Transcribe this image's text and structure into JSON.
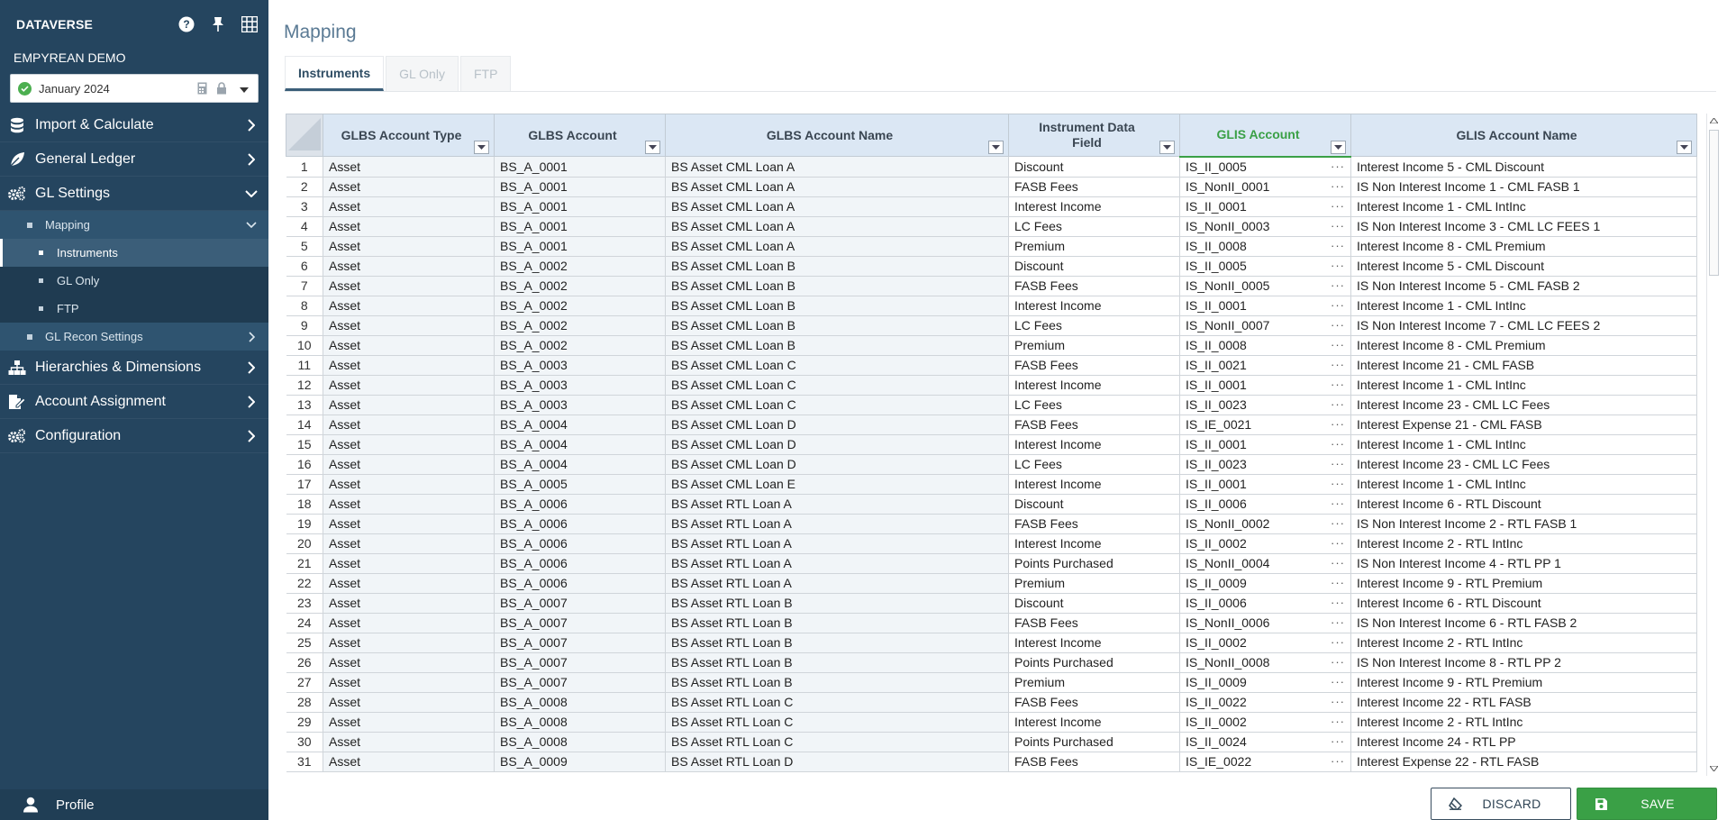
{
  "sidebar": {
    "brand": "DATAVERSE",
    "org": "EMPYREAN DEMO",
    "period": "January 2024",
    "menu": {
      "import_calc": "Import & Calculate",
      "general_ledger": "General Ledger",
      "gl_settings": "GL Settings",
      "mapping": "Mapping",
      "instruments": "Instruments",
      "gl_only": "GL Only",
      "ftp": "FTP",
      "gl_recon": "GL Recon Settings",
      "hierarchies": "Hierarchies & Dimensions",
      "account_assignment": "Account Assignment",
      "configuration": "Configuration"
    },
    "profile": "Profile"
  },
  "main": {
    "title": "Mapping",
    "tabs": [
      "Instruments",
      "GL Only",
      "FTP"
    ]
  },
  "grid": {
    "headers": {
      "type": "GLBS Account Type",
      "account": "GLBS Account",
      "name": "GLBS Account Name",
      "field_l1": "Instrument Data",
      "field_l2": "Field",
      "glis": "GLIS Account",
      "glis_name": "GLIS Account Name"
    },
    "rows": [
      [
        "1",
        "Asset",
        "BS_A_0001",
        "BS Asset CML Loan A",
        "Discount",
        "IS_II_0005",
        "Interest Income 5 - CML Discount"
      ],
      [
        "2",
        "Asset",
        "BS_A_0001",
        "BS Asset CML Loan A",
        "FASB Fees",
        "IS_NonII_0001",
        "IS Non Interest Income 1 - CML FASB 1"
      ],
      [
        "3",
        "Asset",
        "BS_A_0001",
        "BS Asset CML Loan A",
        "Interest Income",
        "IS_II_0001",
        "Interest Income 1 - CML IntInc"
      ],
      [
        "4",
        "Asset",
        "BS_A_0001",
        "BS Asset CML Loan A",
        "LC Fees",
        "IS_NonII_0003",
        "IS Non Interest Income 3 - CML LC FEES 1"
      ],
      [
        "5",
        "Asset",
        "BS_A_0001",
        "BS Asset CML Loan A",
        "Premium",
        "IS_II_0008",
        "Interest Income 8 - CML Premium"
      ],
      [
        "6",
        "Asset",
        "BS_A_0002",
        "BS Asset CML Loan B",
        "Discount",
        "IS_II_0005",
        "Interest Income 5 - CML Discount"
      ],
      [
        "7",
        "Asset",
        "BS_A_0002",
        "BS Asset CML Loan B",
        "FASB Fees",
        "IS_NonII_0005",
        "IS Non Interest Income 5 - CML FASB 2"
      ],
      [
        "8",
        "Asset",
        "BS_A_0002",
        "BS Asset CML Loan B",
        "Interest Income",
        "IS_II_0001",
        "Interest Income 1 - CML IntInc"
      ],
      [
        "9",
        "Asset",
        "BS_A_0002",
        "BS Asset CML Loan B",
        "LC Fees",
        "IS_NonII_0007",
        "IS Non Interest Income 7 - CML LC FEES 2"
      ],
      [
        "10",
        "Asset",
        "BS_A_0002",
        "BS Asset CML Loan B",
        "Premium",
        "IS_II_0008",
        "Interest Income 8 - CML Premium"
      ],
      [
        "11",
        "Asset",
        "BS_A_0003",
        "BS Asset CML Loan C",
        "FASB Fees",
        "IS_II_0021",
        "Interest Income 21 - CML FASB"
      ],
      [
        "12",
        "Asset",
        "BS_A_0003",
        "BS Asset CML Loan C",
        "Interest Income",
        "IS_II_0001",
        "Interest Income 1 - CML IntInc"
      ],
      [
        "13",
        "Asset",
        "BS_A_0003",
        "BS Asset CML Loan C",
        "LC Fees",
        "IS_II_0023",
        "Interest Income 23 - CML LC Fees"
      ],
      [
        "14",
        "Asset",
        "BS_A_0004",
        "BS Asset CML Loan D",
        "FASB Fees",
        "IS_IE_0021",
        "Interest Expense 21 - CML FASB"
      ],
      [
        "15",
        "Asset",
        "BS_A_0004",
        "BS Asset CML Loan D",
        "Interest Income",
        "IS_II_0001",
        "Interest Income 1 - CML IntInc"
      ],
      [
        "16",
        "Asset",
        "BS_A_0004",
        "BS Asset CML Loan D",
        "LC Fees",
        "IS_II_0023",
        "Interest Income 23 - CML LC Fees"
      ],
      [
        "17",
        "Asset",
        "BS_A_0005",
        "BS Asset CML Loan E",
        "Interest Income",
        "IS_II_0001",
        "Interest Income 1 - CML IntInc"
      ],
      [
        "18",
        "Asset",
        "BS_A_0006",
        "BS Asset RTL Loan A",
        "Discount",
        "IS_II_0006",
        "Interest Income 6 - RTL Discount"
      ],
      [
        "19",
        "Asset",
        "BS_A_0006",
        "BS Asset RTL Loan A",
        "FASB Fees",
        "IS_NonII_0002",
        "IS Non Interest Income 2  - RTL FASB 1"
      ],
      [
        "20",
        "Asset",
        "BS_A_0006",
        "BS Asset RTL Loan A",
        "Interest Income",
        "IS_II_0002",
        "Interest Income 2 - RTL IntInc"
      ],
      [
        "21",
        "Asset",
        "BS_A_0006",
        "BS Asset RTL Loan A",
        "Points Purchased",
        "IS_NonII_0004",
        "IS Non Interest Income 4 - RTL PP 1"
      ],
      [
        "22",
        "Asset",
        "BS_A_0006",
        "BS Asset RTL Loan A",
        "Premium",
        "IS_II_0009",
        "Interest Income 9 - RTL Premium"
      ],
      [
        "23",
        "Asset",
        "BS_A_0007",
        "BS Asset RTL Loan B",
        "Discount",
        "IS_II_0006",
        "Interest Income 6 - RTL Discount"
      ],
      [
        "24",
        "Asset",
        "BS_A_0007",
        "BS Asset RTL Loan B",
        "FASB Fees",
        "IS_NonII_0006",
        "IS Non Interest Income 6  - RTL FASB 2"
      ],
      [
        "25",
        "Asset",
        "BS_A_0007",
        "BS Asset RTL Loan B",
        "Interest Income",
        "IS_II_0002",
        "Interest Income 2 - RTL IntInc"
      ],
      [
        "26",
        "Asset",
        "BS_A_0007",
        "BS Asset RTL Loan B",
        "Points Purchased",
        "IS_NonII_0008",
        "IS Non Interest Income 8 - RTL PP 2"
      ],
      [
        "27",
        "Asset",
        "BS_A_0007",
        "BS Asset RTL Loan B",
        "Premium",
        "IS_II_0009",
        "Interest Income 9 - RTL Premium"
      ],
      [
        "28",
        "Asset",
        "BS_A_0008",
        "BS Asset RTL Loan C",
        "FASB Fees",
        "IS_II_0022",
        "Interest Income 22 - RTL FASB"
      ],
      [
        "29",
        "Asset",
        "BS_A_0008",
        "BS Asset RTL Loan C",
        "Interest Income",
        "IS_II_0002",
        "Interest Income 2 - RTL IntInc"
      ],
      [
        "30",
        "Asset",
        "BS_A_0008",
        "BS Asset RTL Loan C",
        "Points Purchased",
        "IS_II_0024",
        "Interest Income 24 - RTL PP"
      ],
      [
        "31",
        "Asset",
        "BS_A_0009",
        "BS Asset RTL Loan D",
        "FASB Fees",
        "IS_IE_0022",
        "Interest Expense 22 - RTL FASB"
      ]
    ]
  },
  "buttons": {
    "discard": "DISCARD",
    "save": "SAVE"
  },
  "colors": {
    "sidebar": "#25455f",
    "header": "#dbe7f4",
    "accent_green": "#3aa046"
  }
}
